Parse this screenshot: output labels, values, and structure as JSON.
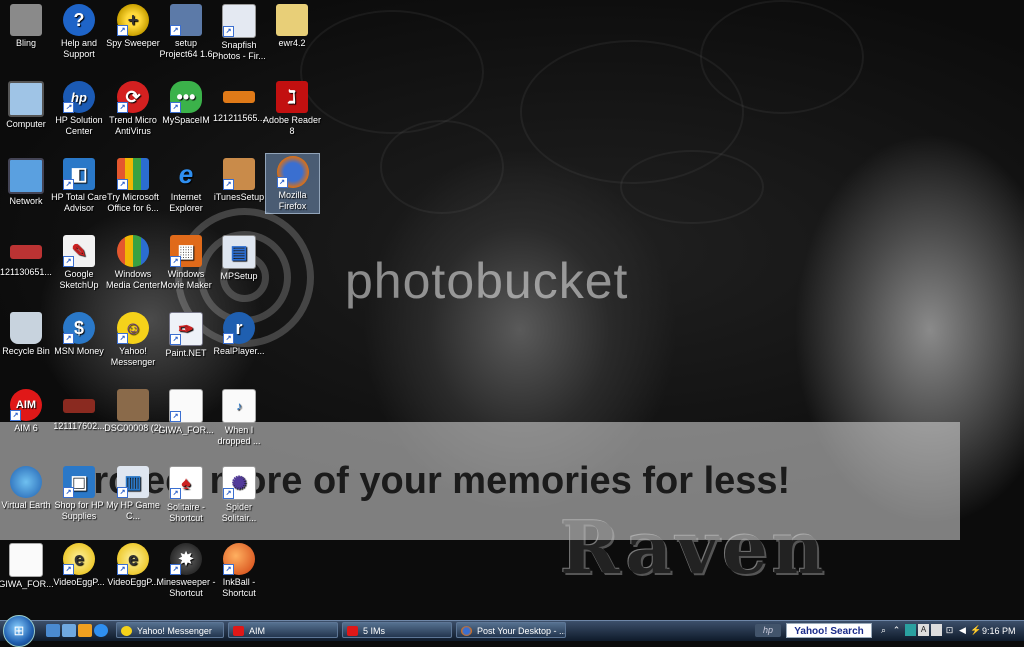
{
  "watermark": {
    "brand": "photobucket",
    "banner": "Protect more of your memories for less!"
  },
  "wallpaper_text": "Raven",
  "icons": [
    {
      "label": "Bling"
    },
    {
      "label": "Help and Support"
    },
    {
      "label": "Spy Sweeper"
    },
    {
      "label": "setup Project64 1.6"
    },
    {
      "label": "Snapfish Photos - Fir..."
    },
    {
      "label": "ewr4.2"
    },
    {
      "label": "Computer"
    },
    {
      "label": "HP Solution Center"
    },
    {
      "label": "Trend Micro AntiVirus"
    },
    {
      "label": "MySpaceIM"
    },
    {
      "label": "121211565..."
    },
    {
      "label": "Adobe Reader 8"
    },
    {
      "label": "Network"
    },
    {
      "label": "HP Total Care Advisor"
    },
    {
      "label": "Try Microsoft Office for 6..."
    },
    {
      "label": "Internet Explorer"
    },
    {
      "label": "iTunesSetup"
    },
    {
      "label": "Mozilla Firefox"
    },
    {
      "label": "121130651..."
    },
    {
      "label": "Google SketchUp"
    },
    {
      "label": "Windows Media Center"
    },
    {
      "label": "Windows Movie Maker"
    },
    {
      "label": "MPSetup"
    },
    {
      "label": "Recycle Bin"
    },
    {
      "label": "MSN Money"
    },
    {
      "label": "Yahoo! Messenger"
    },
    {
      "label": "Paint.NET"
    },
    {
      "label": "RealPlayer..."
    },
    {
      "label": "AIM 6"
    },
    {
      "label": "121117602..."
    },
    {
      "label": "DSC00008 (2)"
    },
    {
      "label": "GIWA_FOR..."
    },
    {
      "label": "When I dropped ..."
    },
    {
      "label": "Virtual Earth"
    },
    {
      "label": "Shop for HP Supplies"
    },
    {
      "label": "My HP Game C..."
    },
    {
      "label": "Solitaire - Shortcut"
    },
    {
      "label": "Spider Solitair..."
    },
    {
      "label": "GIWA_FOR..."
    },
    {
      "label": "VideoEggP..."
    },
    {
      "label": "VideoEggP..."
    },
    {
      "label": "Minesweeper - Shortcut"
    },
    {
      "label": "InkBall - Shortcut"
    }
  ],
  "taskbar": {
    "tasks": [
      {
        "label": "Yahoo! Messenger"
      },
      {
        "label": "AIM"
      },
      {
        "label": "5 IMs"
      },
      {
        "label": "Post Your Desktop - ..."
      }
    ],
    "hp_label": "hp",
    "search_label": "Yahoo! Search",
    "clock": "9:16 PM"
  }
}
